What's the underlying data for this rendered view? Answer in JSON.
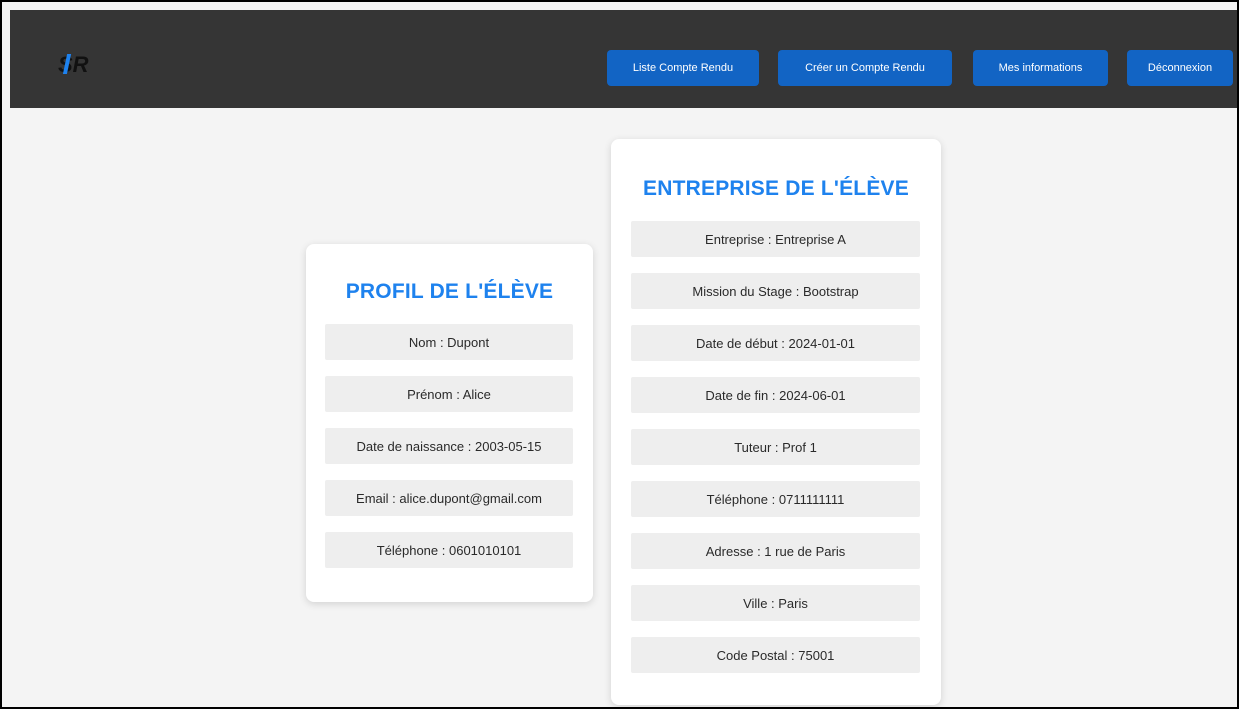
{
  "navbar": {
    "logo_text": "SR",
    "buttons": [
      {
        "label": "Liste Compte Rendu"
      },
      {
        "label": "Créer un Compte Rendu"
      },
      {
        "label": "Mes informations"
      },
      {
        "label": "Déconnexion"
      }
    ],
    "background_color": "#353535",
    "button_color": "#1264c4"
  },
  "profile": {
    "title": "PROFIL DE L'ÉLÈVE",
    "fields": [
      "Nom : Dupont",
      "Prénom : Alice",
      "Date de naissance : 2003-05-15",
      "Email : alice.dupont@gmail.com",
      "Téléphone : 0601010101"
    ]
  },
  "company": {
    "title": "ENTREPRISE DE L'ÉLÈVE",
    "fields": [
      "Entreprise : Entreprise A",
      "Mission du Stage : Bootstrap",
      "Date de début : 2024-01-01",
      "Date de fin : 2024-06-01",
      "Tuteur : Prof 1",
      "Téléphone : 0711111111",
      "Adresse : 1 rue de Paris",
      "Ville : Paris",
      "Code Postal : 75001"
    ]
  },
  "accent_color": "#1e82ee"
}
